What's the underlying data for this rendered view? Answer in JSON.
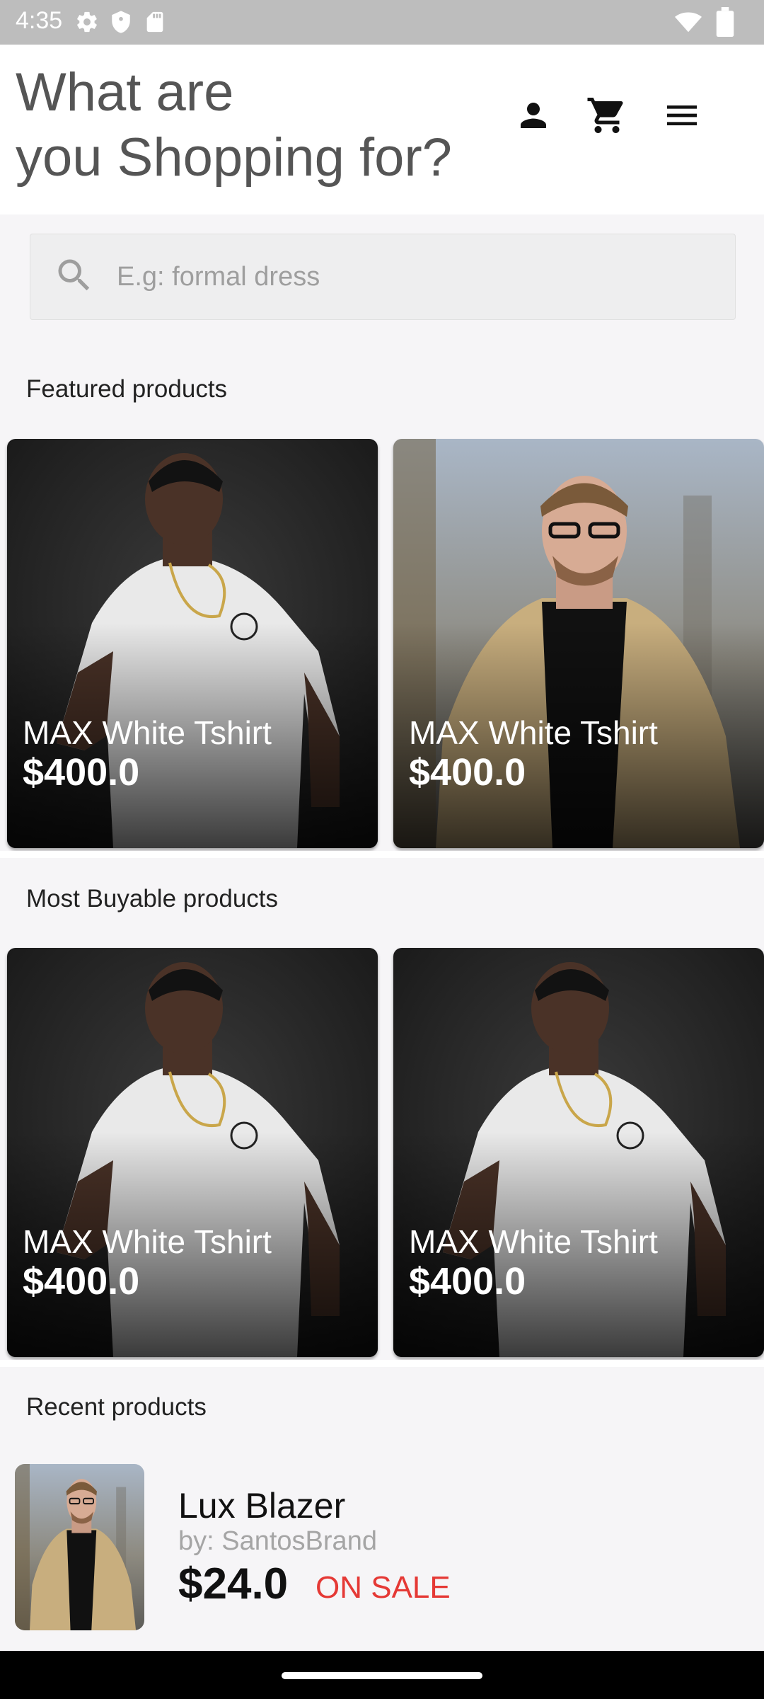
{
  "status_bar": {
    "time": "4:35"
  },
  "header": {
    "title": "What are\nyou Shopping for?"
  },
  "search": {
    "placeholder": "E.g: formal dress"
  },
  "sections": {
    "featured": {
      "title": "Featured products",
      "items": [
        {
          "name": "MAX White Tshirt",
          "price": "$400.0"
        },
        {
          "name": "MAX White Tshirt",
          "price": "$400.0"
        }
      ]
    },
    "most_buyable": {
      "title": "Most Buyable products",
      "items": [
        {
          "name": "MAX White Tshirt",
          "price": "$400.0"
        },
        {
          "name": "MAX White Tshirt",
          "price": "$400.0"
        }
      ]
    },
    "recent": {
      "title": "Recent products",
      "items": [
        {
          "name": "Lux Blazer",
          "brand": "by: SantosBrand",
          "price": "$24.0",
          "badge": "ON SALE"
        }
      ]
    }
  },
  "colors": {
    "sale": "#e53935",
    "status_bar": "#bdbdbd",
    "background": "#f6f5f7"
  }
}
